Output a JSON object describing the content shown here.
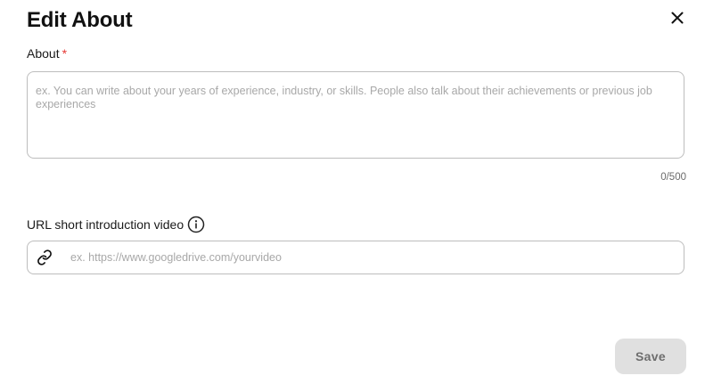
{
  "dialog": {
    "title": "Edit About",
    "close_icon": "close-icon"
  },
  "about": {
    "label": "About",
    "required_marker": "*",
    "value": "",
    "placeholder": "ex. You can write about your years of experience, industry, or skills. People also talk about their achievements or previous job experiences",
    "counter": "0/500"
  },
  "video": {
    "label": "URL short introduction video",
    "info_icon": "info-icon",
    "link_icon": "link-icon",
    "value": "",
    "placeholder": "ex. https://www.googledrive.com/yourvideo"
  },
  "actions": {
    "save_label": "Save"
  },
  "colors": {
    "required": "#e53935",
    "border": "#bdbdbd",
    "placeholder": "#a8a8a8",
    "save_bg": "#e0e0e0",
    "save_text": "#6e6e6e"
  }
}
